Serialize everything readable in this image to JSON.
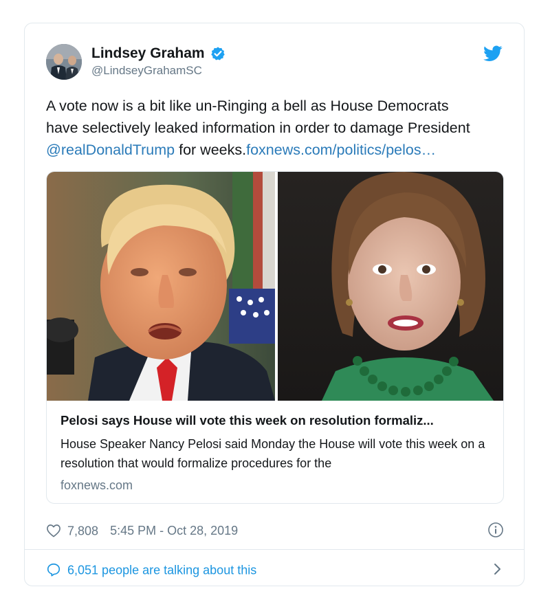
{
  "tweet": {
    "author": {
      "display_name": "Lindsey Graham",
      "handle": "@LindseyGrahamSC",
      "verified": true
    },
    "text": {
      "line1": "A vote now is a bit like un-Ringing a bell as House Democrats",
      "line2": "have selectively leaked information in order to damage President",
      "mention": "@realDonaldTrump",
      "middle": " for weeks.",
      "url": "foxnews.com/politics/pelos…"
    },
    "link_preview": {
      "title": "Pelosi says House will vote this week on resolution formaliz...",
      "description": "House Speaker Nancy Pelosi said Monday the House will vote this week on a resolution that would formalize procedures for the",
      "domain": "foxnews.com"
    },
    "likes": "7,808",
    "timestamp": "5:45 PM - Oct 28, 2019",
    "talking_about": "6,051 people are talking about this"
  },
  "colors": {
    "link": "#2b7bb9",
    "accent": "#1da1f2",
    "secondary_text": "#657786",
    "border": "#e1e8ed"
  },
  "icons": {
    "verified": "verified-badge-icon",
    "brand": "twitter-bird-icon",
    "like": "heart-icon",
    "info": "info-icon",
    "reply": "speech-bubble-icon",
    "chevron": "chevron-right-icon"
  }
}
